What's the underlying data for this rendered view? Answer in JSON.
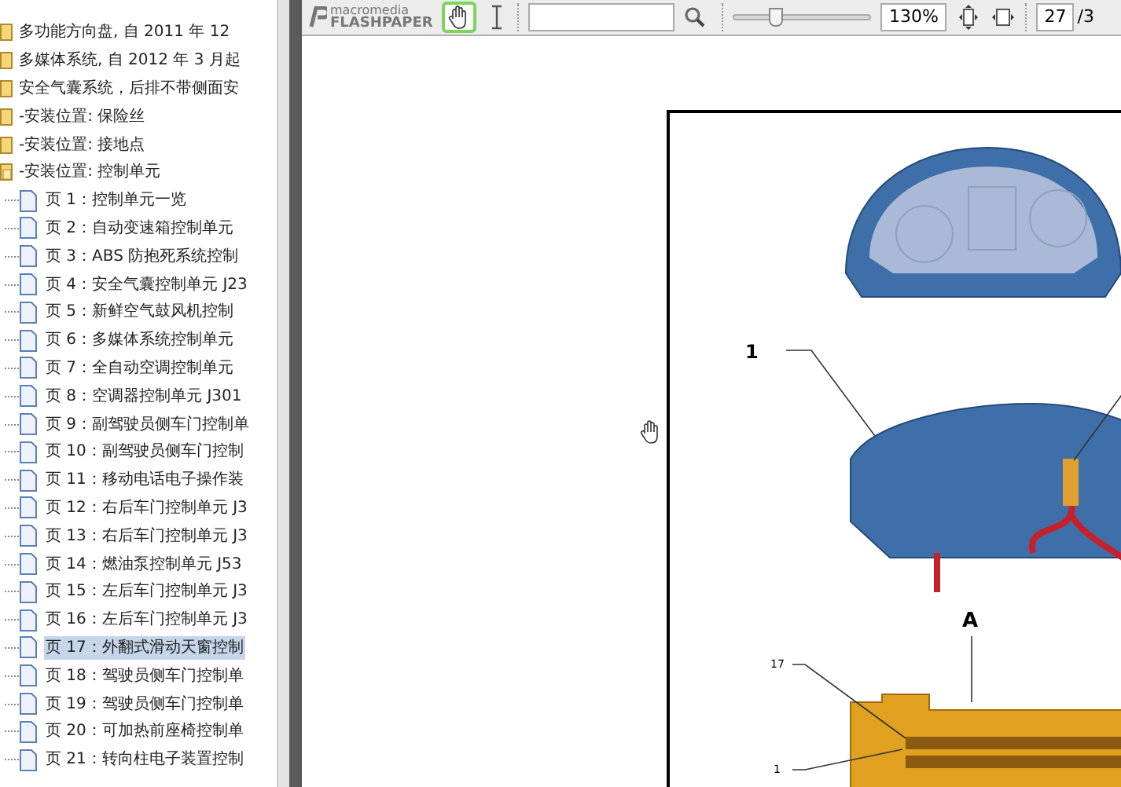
{
  "outline": [
    {
      "kind": "folder",
      "label": "多功能方向盘, 自 2011 年 12",
      "expanded": false
    },
    {
      "kind": "folder",
      "label": "多媒体系统, 自 2012 年 3 月起",
      "expanded": false
    },
    {
      "kind": "folder",
      "label": "安全气囊系统，后排不带侧面安",
      "expanded": false
    },
    {
      "kind": "folder",
      "label": "-安装位置: 保险丝",
      "expanded": false
    },
    {
      "kind": "folder",
      "label": "-安装位置: 接地点",
      "expanded": false
    },
    {
      "kind": "folder",
      "label": "-安装位置: 控制单元",
      "expanded": true,
      "children": [
        {
          "kind": "page",
          "label": "页 1：控制单元一览",
          "selected": false
        },
        {
          "kind": "page",
          "label": "页 2：自动变速箱控制单元",
          "selected": false
        },
        {
          "kind": "page",
          "label": "页 3：ABS 防抱死系统控制",
          "selected": false
        },
        {
          "kind": "page",
          "label": "页 4：安全气囊控制单元 J23",
          "selected": false
        },
        {
          "kind": "page",
          "label": "页 5：新鲜空气鼓风机控制",
          "selected": false
        },
        {
          "kind": "page",
          "label": "页 6：多媒体系统控制单元",
          "selected": false
        },
        {
          "kind": "page",
          "label": "页 7：全自动空调控制单元",
          "selected": false
        },
        {
          "kind": "page",
          "label": "页 8：空调器控制单元 J301",
          "selected": false
        },
        {
          "kind": "page",
          "label": "页 9：副驾驶员侧车门控制单",
          "selected": false
        },
        {
          "kind": "page",
          "label": "页 10：副驾驶员侧车门控制",
          "selected": false
        },
        {
          "kind": "page",
          "label": "页 11：移动电话电子操作装",
          "selected": false
        },
        {
          "kind": "page",
          "label": "页 12：右后车门控制单元 J3",
          "selected": false
        },
        {
          "kind": "page",
          "label": "页 13：右后车门控制单元 J3",
          "selected": false
        },
        {
          "kind": "page",
          "label": "页 14：燃油泵控制单元 J53",
          "selected": false
        },
        {
          "kind": "page",
          "label": "页 15：左后车门控制单元 J3",
          "selected": false
        },
        {
          "kind": "page",
          "label": "页 16：左后车门控制单元 J3",
          "selected": false
        },
        {
          "kind": "page",
          "label": "页 17：外翻式滑动天窗控制",
          "selected": true
        },
        {
          "kind": "page",
          "label": "页 18：驾驶员侧车门控制单",
          "selected": false
        },
        {
          "kind": "page",
          "label": "页 19：驾驶员侧车门控制单",
          "selected": false
        },
        {
          "kind": "page",
          "label": "页 20：可加热前座椅控制单",
          "selected": false
        },
        {
          "kind": "page",
          "label": "页 21：转向柱电子装置控制",
          "selected": false
        }
      ]
    }
  ],
  "toolbar": {
    "logo_top": "macromedia",
    "logo_bottom": "FLASHPAPER",
    "hand_tool_selected": true,
    "zoom_slider": {
      "level": 0.3
    },
    "zoom": "130%",
    "page": "27",
    "page_total": "/3"
  },
  "figure": {
    "labels": [
      "1",
      "A",
      "17",
      "1"
    ]
  }
}
